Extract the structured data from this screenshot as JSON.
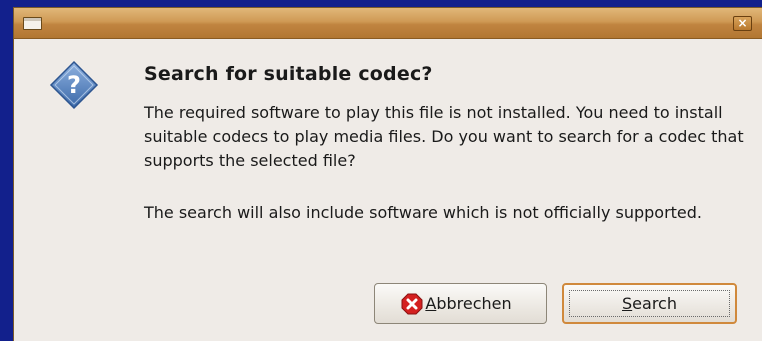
{
  "window": {
    "title": "",
    "menu_icon": "window-menu-icon",
    "close_icon": "close-icon",
    "close_glyph": "×"
  },
  "dialog": {
    "icon": "question-icon",
    "icon_glyph": "?",
    "heading": "Search for suitable codec?",
    "paragraph_1": "The required software to play this file is not installed. You need to install suitable codecs to play media files. Do you want to search for a codec that supports the selected file?",
    "paragraph_2": "The search will also include software which is not officially supported."
  },
  "buttons": {
    "cancel": {
      "icon": "cancel-icon",
      "mnemonic": "A",
      "rest": "bbrechen"
    },
    "search": {
      "mnemonic": "S",
      "rest": "earch"
    }
  },
  "colors": {
    "desktop": "#12208c",
    "titlebar": "#c08440",
    "dialog_bg": "#efebe7",
    "focus_border": "#d0893c",
    "question_icon": "#4a78b8",
    "cancel_icon": "#d42020"
  }
}
